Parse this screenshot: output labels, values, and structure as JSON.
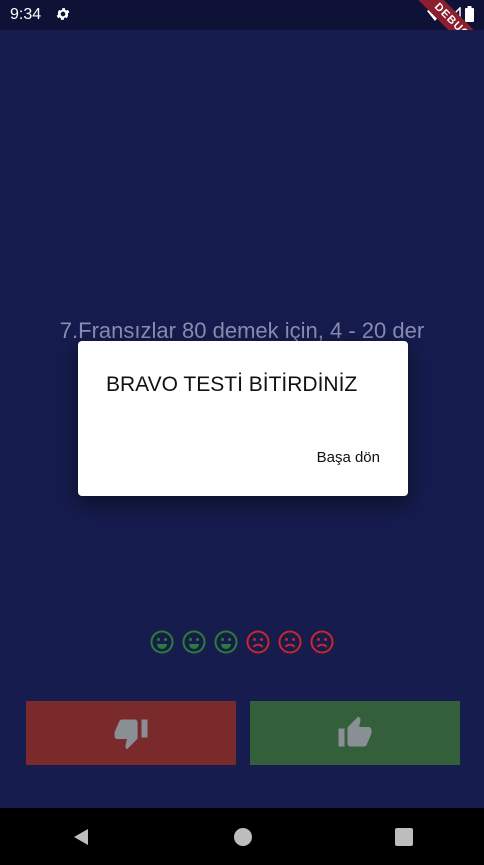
{
  "status_bar": {
    "time": "9:34",
    "debug_label": "DEBUG"
  },
  "question": {
    "text": "7.Fransızlar 80 demek için, 4 - 20 der"
  },
  "score": {
    "items": [
      "correct",
      "correct",
      "correct",
      "wrong",
      "wrong",
      "wrong"
    ],
    "colors": {
      "correct": "#2e7d32",
      "wrong": "#c62828"
    }
  },
  "buttons": {
    "false_icon": "thumb-down-icon",
    "true_icon": "thumb-up-icon"
  },
  "dialog": {
    "title": "BRAVO TESTİ BİTİRDİNİZ",
    "action_label": "Başa dön"
  },
  "colors": {
    "background": "#161c4e",
    "false_button": "#7a2a2b",
    "true_button": "#335f3a"
  }
}
